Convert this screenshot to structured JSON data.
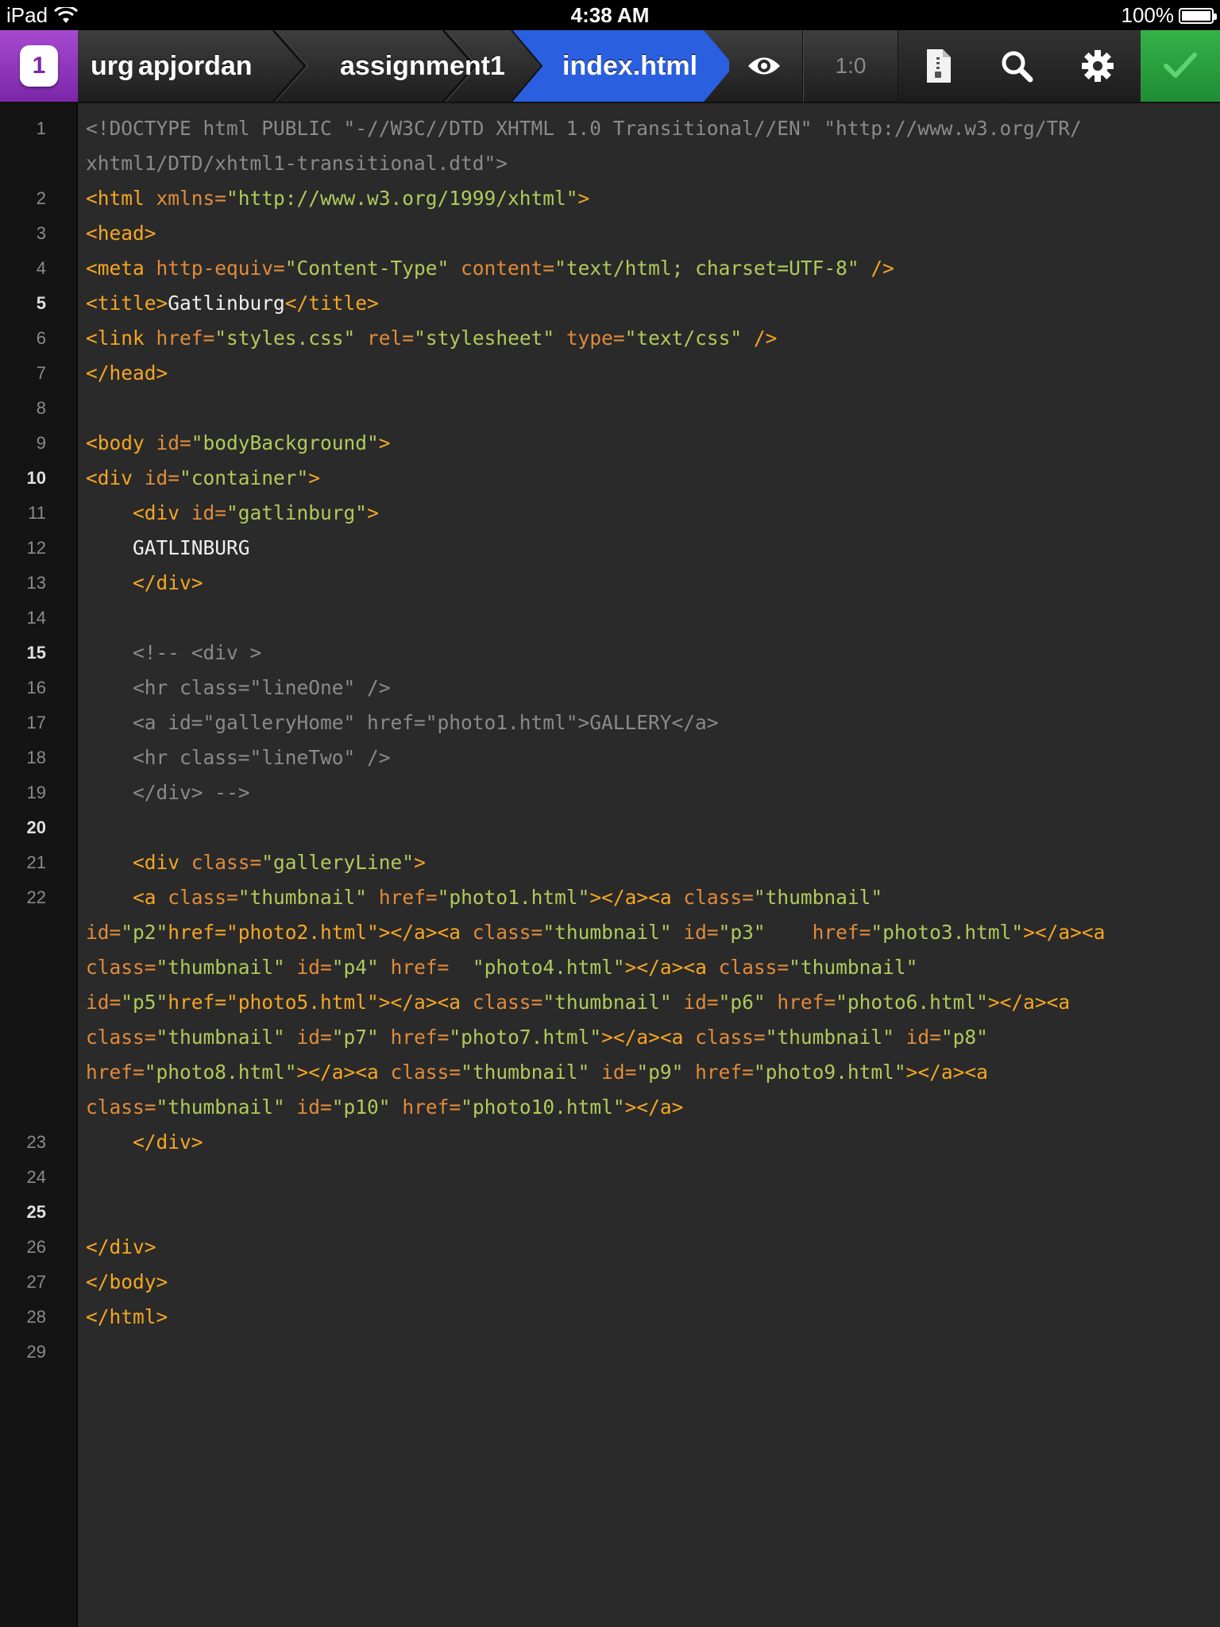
{
  "status_bar": {
    "device": "iPad",
    "time": "4:38 AM",
    "battery_text": "100%",
    "battery_level": 1.0
  },
  "toolbar": {
    "app_badge": "1",
    "breadcrumbs": [
      "urg",
      "apjordan",
      "assignment1",
      "index.html"
    ],
    "active_crumb": "index.html",
    "cursor_position": "1:0",
    "preview_icon": "eye-icon",
    "file_icon": "file-zip-icon",
    "search_icon": "search-icon",
    "settings_icon": "gear-icon",
    "done_icon": "checkmark-icon",
    "active_color": "#2a5fe0",
    "app_color": "#8e35bd",
    "done_color": "#2aa040"
  },
  "editor": {
    "lines": [
      {
        "num": "1",
        "bold": false,
        "wrap": [
          [
            [
              "doctype",
              "<!DOCTYPE html PUBLIC \"-//W3C//DTD XHTML 1.0 Transitional//EN\" \"http://www.w3.org/TR/"
            ]
          ],
          [
            [
              "doctype",
              "xhtml1/DTD/xhtml1-transitional.dtd\">"
            ]
          ]
        ]
      },
      {
        "num": "2",
        "bold": false,
        "wrap": [
          [
            [
              "tag",
              "<html "
            ],
            [
              "attr",
              "xmlns="
            ],
            [
              "val",
              "\"http://www.w3.org/1999/xhtml\""
            ],
            [
              "tag",
              ">"
            ]
          ]
        ]
      },
      {
        "num": "3",
        "bold": false,
        "wrap": [
          [
            [
              "tag",
              "<head>"
            ]
          ]
        ]
      },
      {
        "num": "4",
        "bold": false,
        "wrap": [
          [
            [
              "tag",
              "<meta "
            ],
            [
              "attr",
              "http-equiv="
            ],
            [
              "val",
              "\"Content-Type\""
            ],
            [
              "attr",
              " content="
            ],
            [
              "val",
              "\"text/html; charset=UTF-8\""
            ],
            [
              "tag",
              " />"
            ]
          ]
        ]
      },
      {
        "num": "5",
        "bold": true,
        "wrap": [
          [
            [
              "tag",
              "<title>"
            ],
            [
              "txt",
              "Gatlinburg"
            ],
            [
              "tag",
              "</title>"
            ]
          ]
        ]
      },
      {
        "num": "6",
        "bold": false,
        "wrap": [
          [
            [
              "tag",
              "<link "
            ],
            [
              "attr",
              "href="
            ],
            [
              "val",
              "\"styles.css\""
            ],
            [
              "attr",
              " rel="
            ],
            [
              "val",
              "\"stylesheet\""
            ],
            [
              "attr",
              " type="
            ],
            [
              "val",
              "\"text/css\""
            ],
            [
              "tag",
              " />"
            ]
          ]
        ]
      },
      {
        "num": "7",
        "bold": false,
        "wrap": [
          [
            [
              "tag",
              "</head>"
            ]
          ]
        ]
      },
      {
        "num": "8",
        "bold": false,
        "wrap": [
          []
        ]
      },
      {
        "num": "9",
        "bold": false,
        "wrap": [
          [
            [
              "tag",
              "<body "
            ],
            [
              "attr",
              "id="
            ],
            [
              "val",
              "\"bodyBackground\""
            ],
            [
              "tag",
              ">"
            ]
          ]
        ]
      },
      {
        "num": "10",
        "bold": true,
        "wrap": [
          [
            [
              "tag",
              "<div "
            ],
            [
              "attr",
              "id="
            ],
            [
              "val",
              "\"container\""
            ],
            [
              "tag",
              ">"
            ]
          ]
        ]
      },
      {
        "num": "11",
        "bold": false,
        "wrap": [
          [
            [
              "txt",
              "    "
            ],
            [
              "tag",
              "<div "
            ],
            [
              "attr",
              "id="
            ],
            [
              "val",
              "\"gatlinburg\""
            ],
            [
              "tag",
              ">"
            ]
          ]
        ]
      },
      {
        "num": "12",
        "bold": false,
        "wrap": [
          [
            [
              "txt",
              "    GATLINBURG"
            ]
          ]
        ]
      },
      {
        "num": "13",
        "bold": false,
        "wrap": [
          [
            [
              "txt",
              "    "
            ],
            [
              "tag",
              "</div>"
            ]
          ]
        ]
      },
      {
        "num": "14",
        "bold": false,
        "wrap": [
          []
        ]
      },
      {
        "num": "15",
        "bold": true,
        "wrap": [
          [
            [
              "cmt",
              "    <!-- <div >"
            ]
          ]
        ]
      },
      {
        "num": "16",
        "bold": false,
        "wrap": [
          [
            [
              "cmt",
              "    <hr class=\"lineOne\" />"
            ]
          ]
        ]
      },
      {
        "num": "17",
        "bold": false,
        "wrap": [
          [
            [
              "cmt",
              "    <a id=\"galleryHome\" href=\"photo1.html\">GALLERY</a>"
            ]
          ]
        ]
      },
      {
        "num": "18",
        "bold": false,
        "wrap": [
          [
            [
              "cmt",
              "    <hr class=\"lineTwo\" />"
            ]
          ]
        ]
      },
      {
        "num": "19",
        "bold": false,
        "wrap": [
          [
            [
              "cmt",
              "    </div> -->"
            ]
          ]
        ]
      },
      {
        "num": "20",
        "bold": true,
        "wrap": [
          []
        ]
      },
      {
        "num": "21",
        "bold": false,
        "wrap": [
          [
            [
              "txt",
              "    "
            ],
            [
              "tag",
              "<div "
            ],
            [
              "attr",
              "class="
            ],
            [
              "val",
              "\"galleryLine\""
            ],
            [
              "tag",
              ">"
            ]
          ]
        ]
      },
      {
        "num": "22",
        "bold": false,
        "wrap": [
          [
            [
              "txt",
              "    "
            ],
            [
              "tag",
              "<a "
            ],
            [
              "attr",
              "class="
            ],
            [
              "val",
              "\"thumbnail\""
            ],
            [
              "attr",
              " href="
            ],
            [
              "val",
              "\"photo1.html\""
            ],
            [
              "tag",
              "></a><a "
            ],
            [
              "attr",
              "class="
            ],
            [
              "val",
              "\"thumbnail\""
            ]
          ],
          [
            [
              "attr",
              "id="
            ],
            [
              "val",
              "\"p2\""
            ],
            [
              "tag",
              "href=\"photo2.html\"></a><a "
            ],
            [
              "attr",
              "class="
            ],
            [
              "val",
              "\"thumbnail\""
            ],
            [
              "attr",
              " id="
            ],
            [
              "val",
              "\"p3\""
            ],
            [
              "attr",
              "    href="
            ],
            [
              "val",
              "\"photo3.html\""
            ],
            [
              "tag",
              "></a><a"
            ]
          ],
          [
            [
              "attr",
              "class="
            ],
            [
              "val",
              "\"thumbnail\""
            ],
            [
              "attr",
              " id="
            ],
            [
              "val",
              "\"p4\""
            ],
            [
              "attr",
              " href=  "
            ],
            [
              "val",
              "\"photo4.html\""
            ],
            [
              "tag",
              "></a><a "
            ],
            [
              "attr",
              "class="
            ],
            [
              "val",
              "\"thumbnail\""
            ]
          ],
          [
            [
              "attr",
              "id="
            ],
            [
              "val",
              "\"p5\""
            ],
            [
              "tag",
              "href=\"photo5.html\"></a><a "
            ],
            [
              "attr",
              "class="
            ],
            [
              "val",
              "\"thumbnail\""
            ],
            [
              "attr",
              " id="
            ],
            [
              "val",
              "\"p6\""
            ],
            [
              "attr",
              " href="
            ],
            [
              "val",
              "\"photo6.html\""
            ],
            [
              "tag",
              "></a><a"
            ]
          ],
          [
            [
              "attr",
              "class="
            ],
            [
              "val",
              "\"thumbnail\""
            ],
            [
              "attr",
              " id="
            ],
            [
              "val",
              "\"p7\""
            ],
            [
              "attr",
              " href="
            ],
            [
              "val",
              "\"photo7.html\""
            ],
            [
              "tag",
              "></a><a "
            ],
            [
              "attr",
              "class="
            ],
            [
              "val",
              "\"thumbnail\""
            ],
            [
              "attr",
              " id="
            ],
            [
              "val",
              "\"p8\""
            ]
          ],
          [
            [
              "attr",
              "href="
            ],
            [
              "val",
              "\"photo8.html\""
            ],
            [
              "tag",
              "></a><a "
            ],
            [
              "attr",
              "class="
            ],
            [
              "val",
              "\"thumbnail\""
            ],
            [
              "attr",
              " id="
            ],
            [
              "val",
              "\"p9\""
            ],
            [
              "attr",
              " href="
            ],
            [
              "val",
              "\"photo9.html\""
            ],
            [
              "tag",
              "></a><a"
            ]
          ],
          [
            [
              "attr",
              "class="
            ],
            [
              "val",
              "\"thumbnail\""
            ],
            [
              "attr",
              " id="
            ],
            [
              "val",
              "\"p10\""
            ],
            [
              "attr",
              " href="
            ],
            [
              "val",
              "\"photo10.html\""
            ],
            [
              "tag",
              "></a>"
            ]
          ]
        ]
      },
      {
        "num": "23",
        "bold": false,
        "wrap": [
          [
            [
              "txt",
              "    "
            ],
            [
              "tag",
              "</div>"
            ]
          ]
        ]
      },
      {
        "num": "24",
        "bold": false,
        "wrap": [
          []
        ]
      },
      {
        "num": "25",
        "bold": true,
        "wrap": [
          []
        ]
      },
      {
        "num": "26",
        "bold": false,
        "wrap": [
          [
            [
              "tag",
              "</div>"
            ]
          ]
        ]
      },
      {
        "num": "27",
        "bold": false,
        "wrap": [
          [
            [
              "tag",
              "</body>"
            ]
          ]
        ]
      },
      {
        "num": "28",
        "bold": false,
        "wrap": [
          [
            [
              "tag",
              "</html>"
            ]
          ]
        ]
      },
      {
        "num": "29",
        "bold": false,
        "wrap": [
          []
        ]
      }
    ]
  }
}
